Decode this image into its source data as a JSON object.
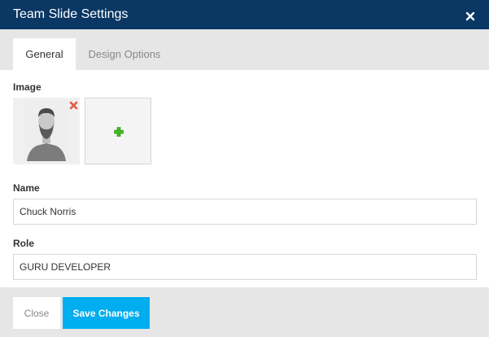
{
  "dialog": {
    "title": "Team Slide Settings",
    "close_icon": "close-icon"
  },
  "tabs": [
    {
      "label": "General",
      "active": true
    },
    {
      "label": "Design Options",
      "active": false
    }
  ],
  "form": {
    "image_label": "Image",
    "image_remove_icon": "remove-icon",
    "image_add_icon": "plus-icon",
    "name_label": "Name",
    "name_value": "Chuck Norris",
    "role_label": "Role",
    "role_value": "GURU DEVELOPER"
  },
  "footer": {
    "close_label": "Close",
    "save_label": "Save Changes"
  },
  "colors": {
    "titlebar": "#0a3764",
    "accent": "#00aef0",
    "panel": "#e6e6e6"
  }
}
